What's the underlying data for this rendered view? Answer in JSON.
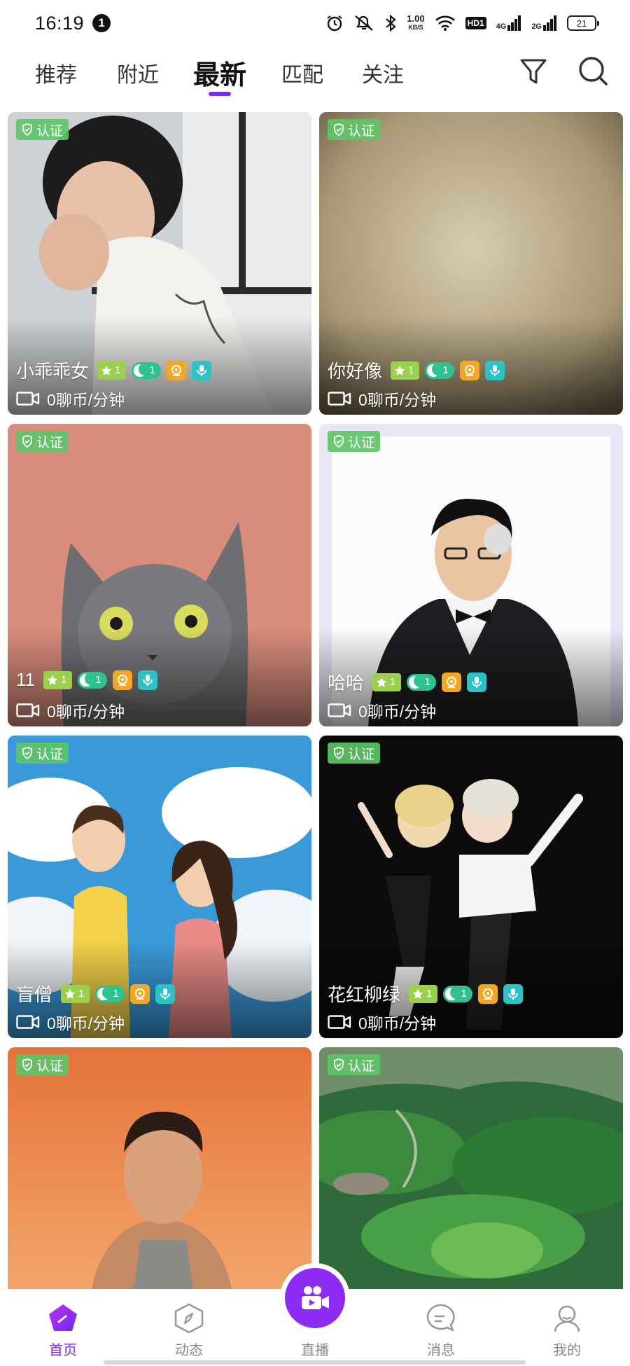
{
  "status": {
    "time": "16:19",
    "notif_count": "1",
    "speed_top": "1.00",
    "speed_bottom": "KB/S",
    "hd": "HD1",
    "net1": "4G",
    "net2": "2G",
    "battery": "21"
  },
  "tabs": [
    {
      "label": "推荐",
      "active": false
    },
    {
      "label": "附近",
      "active": false
    },
    {
      "label": "最新",
      "active": true
    },
    {
      "label": "匹配",
      "active": false
    },
    {
      "label": "关注",
      "active": false
    }
  ],
  "header_icons": {
    "filter": "filter-icon",
    "search": "search-icon"
  },
  "accent_color": "#7a2cf0",
  "verify_label": "认证",
  "cards": [
    {
      "name": "小乖乖女",
      "star_level": "1",
      "moon_level": "1",
      "price": "0聊币/分钟"
    },
    {
      "name": "你好像",
      "star_level": "1",
      "moon_level": "1",
      "price": "0聊币/分钟"
    },
    {
      "name": "11",
      "star_level": "1",
      "moon_level": "1",
      "price": "0聊币/分钟"
    },
    {
      "name": "哈哈",
      "star_level": "1",
      "moon_level": "1",
      "price": "0聊币/分钟"
    },
    {
      "name": "盲僧",
      "star_level": "1",
      "moon_level": "1",
      "price": "0聊币/分钟"
    },
    {
      "name": "花红柳绿",
      "star_level": "1",
      "moon_level": "1",
      "price": "0聊币/分钟"
    },
    {
      "name": "",
      "star_level": "",
      "moon_level": "",
      "price": ""
    },
    {
      "name": "",
      "star_level": "",
      "moon_level": "",
      "price": ""
    }
  ],
  "bottom_nav": [
    {
      "label": "首页",
      "icon": "home-icon",
      "active": true
    },
    {
      "label": "动态",
      "icon": "compass-icon",
      "active": false
    },
    {
      "label": "直播",
      "icon": "live-camera-icon",
      "active": false
    },
    {
      "label": "消息",
      "icon": "message-icon",
      "active": false
    },
    {
      "label": "我的",
      "icon": "profile-icon",
      "active": false
    }
  ]
}
